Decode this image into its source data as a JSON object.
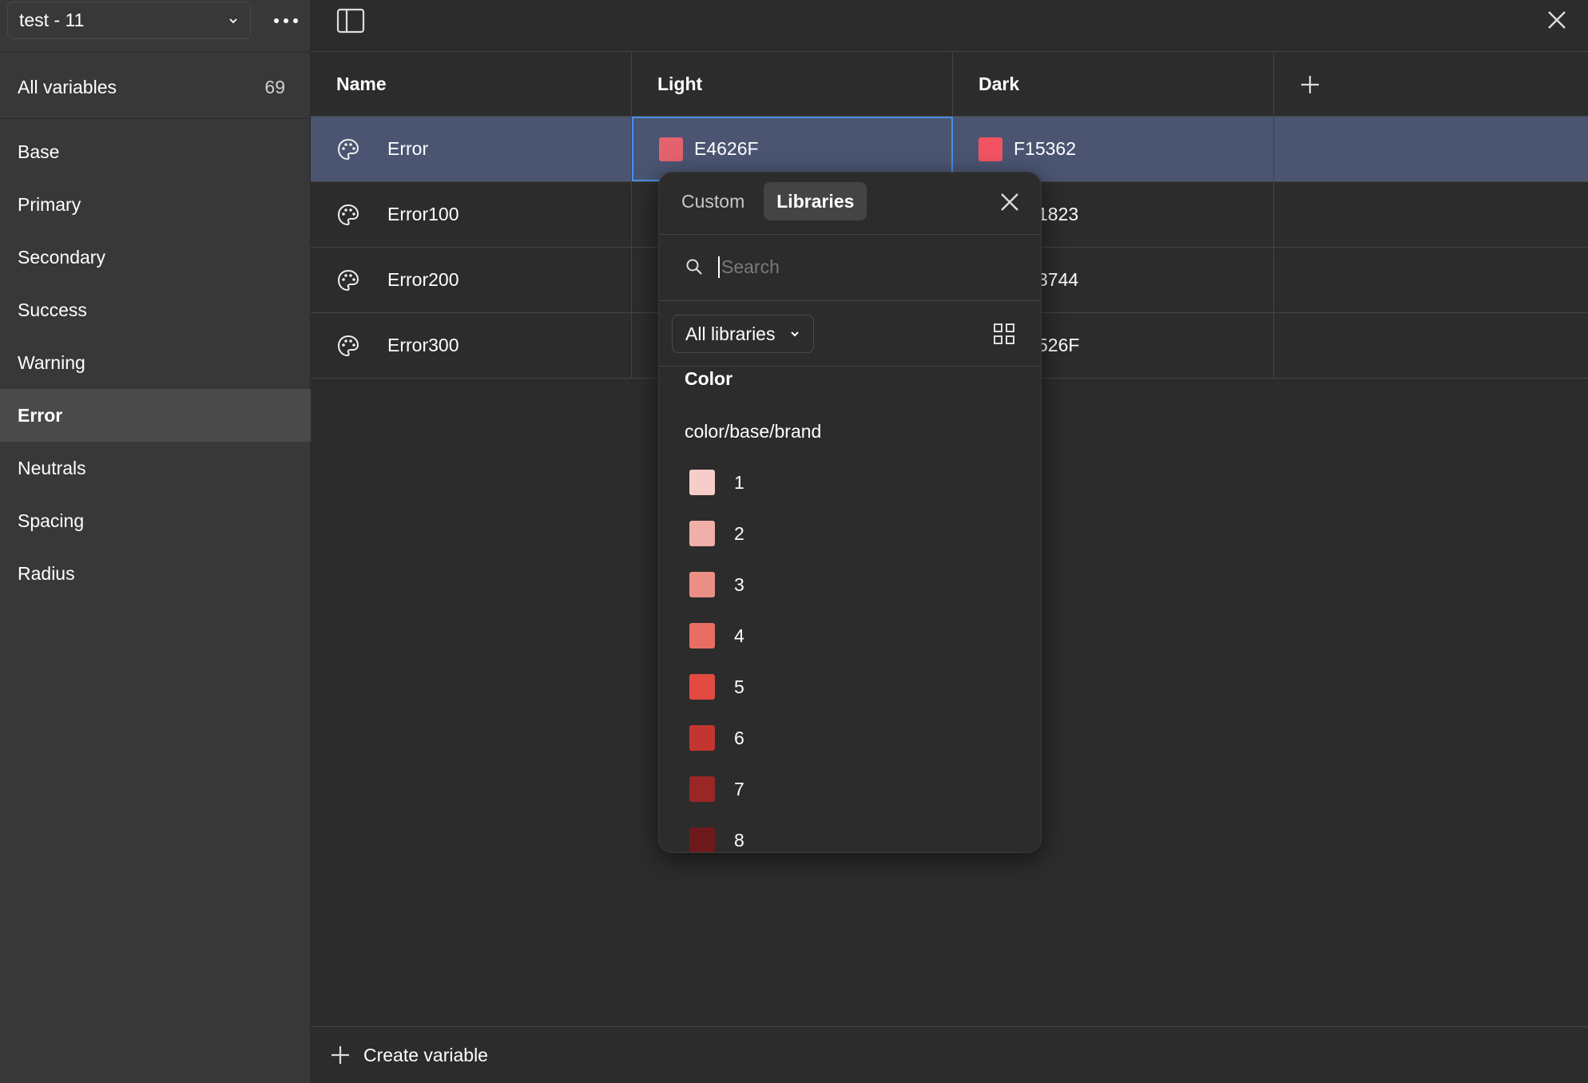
{
  "sidebar": {
    "collection": "test - 11",
    "all_variables": {
      "label": "All variables",
      "count": "69"
    },
    "groups": [
      {
        "label": "Base",
        "active": false
      },
      {
        "label": "Primary",
        "active": false
      },
      {
        "label": "Secondary",
        "active": false
      },
      {
        "label": "Success",
        "active": false
      },
      {
        "label": "Warning",
        "active": false
      },
      {
        "label": "Error",
        "active": true
      },
      {
        "label": "Neutrals",
        "active": false
      },
      {
        "label": "Spacing",
        "active": false
      },
      {
        "label": "Radius",
        "active": false
      }
    ]
  },
  "table": {
    "headers": {
      "name": "Name",
      "light": "Light",
      "dark": "Dark"
    },
    "rows": [
      {
        "name": "Error",
        "light": "E4626F",
        "light_color": "#E4626F",
        "dark": "F15362",
        "dark_color": "#F15362"
      },
      {
        "name": "Error100",
        "dark": "1823"
      },
      {
        "name": "Error200",
        "dark": "3744"
      },
      {
        "name": "Error300",
        "dark": "526F"
      }
    ]
  },
  "footer": {
    "create_label": "Create variable"
  },
  "popover": {
    "tabs": [
      {
        "label": "Custom",
        "active": false
      },
      {
        "label": "Libraries",
        "active": true
      }
    ],
    "search_placeholder": "Search",
    "library_filter": "All libraries",
    "section": "Color",
    "path": "color/base/brand",
    "colors": [
      {
        "label": "1",
        "hex": "#F6CDC8"
      },
      {
        "label": "2",
        "hex": "#F0AFA8"
      },
      {
        "label": "3",
        "hex": "#EB8F86"
      },
      {
        "label": "4",
        "hex": "#E86E64"
      },
      {
        "label": "5",
        "hex": "#E24A42"
      },
      {
        "label": "6",
        "hex": "#C23530"
      },
      {
        "label": "7",
        "hex": "#9A2625"
      },
      {
        "label": "8",
        "hex": "#6E1A1C"
      }
    ]
  }
}
